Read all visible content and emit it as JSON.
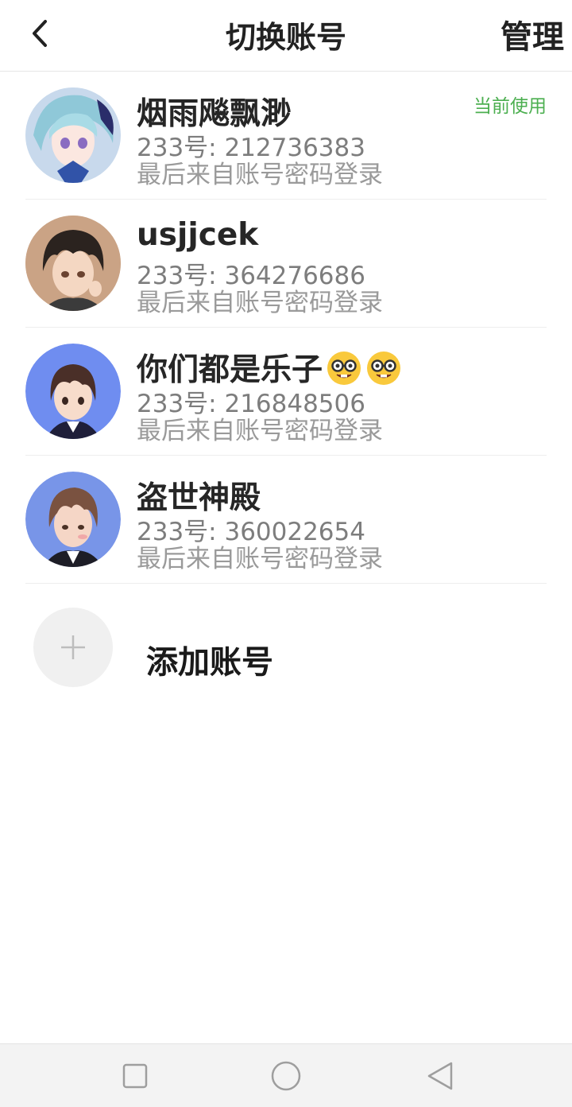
{
  "header": {
    "title": "切换账号",
    "manage_label": "管理",
    "back_icon": "chevron-left-icon"
  },
  "accounts": [
    {
      "name": "烟雨飚飘渺",
      "uid": "233号: 212736383",
      "login_source": "最后来自账号密码登录",
      "current_label": "当前使用"
    },
    {
      "name": "usjjcek",
      "uid": "233号: 364276686",
      "login_source": "最后来自账号密码登录"
    },
    {
      "name": "你们都是乐子",
      "name_emoji": "nerd-face-emoji",
      "uid": "233号: 216848506",
      "login_source": "最后来自账号密码登录"
    },
    {
      "name": "盗世神殿",
      "uid": "233号: 360022654",
      "login_source": "最后来自账号密码登录"
    }
  ],
  "add_account": {
    "label": "添加账号",
    "icon": "plus-icon"
  },
  "colors": {
    "current_tag": "#4caf50",
    "navbar_bg": "#f3f3f3"
  },
  "navbar": {
    "icons": [
      "recent-apps-icon",
      "home-icon",
      "back-icon"
    ]
  }
}
